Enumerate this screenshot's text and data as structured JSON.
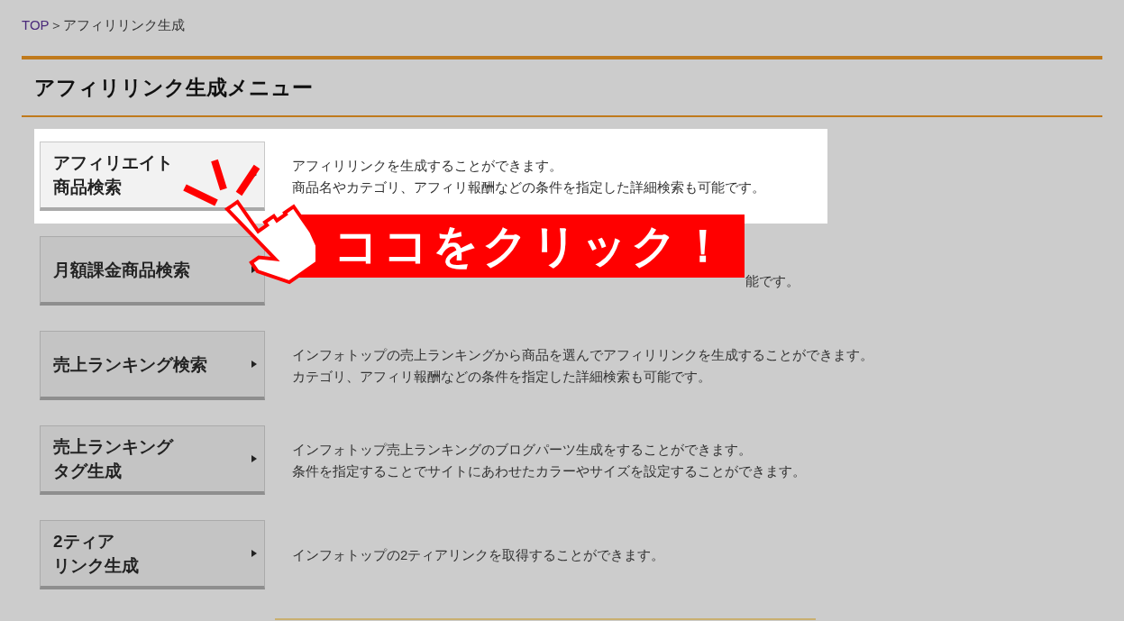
{
  "breadcrumb": {
    "link": "TOP",
    "separator": "＞",
    "current": "アフィリリンク生成"
  },
  "heading": "アフィリリンク生成メニュー",
  "menu": [
    {
      "label": [
        "アフィリエイト",
        "商品検索"
      ],
      "highlighted": true,
      "description": [
        "アフィリリンクを生成することができます。",
        "商品名やカテゴリ、アフィリ報酬などの条件を指定した詳細検索も可能です。"
      ]
    },
    {
      "label": [
        "月額課金商品検索"
      ],
      "highlighted": false,
      "callout": {
        "text": "ココをクリック！"
      },
      "description": [
        "能です。"
      ]
    },
    {
      "label": [
        "売上ランキング検索"
      ],
      "highlighted": false,
      "description": [
        "インフォトップの売上ランキングから商品を選んでアフィリリンクを生成することができます。",
        "カテゴリ、アフィリ報酬などの条件を指定した詳細検索も可能です。"
      ]
    },
    {
      "label": [
        "売上ランキング",
        "タグ生成"
      ],
      "highlighted": false,
      "description": [
        "インフォトップ売上ランキングのブログパーツ生成をすることができます。",
        "条件を指定することでサイトにあわせたカラーやサイズを設定することができます。"
      ]
    },
    {
      "label": [
        "2ティア",
        "リンク生成"
      ],
      "highlighted": false,
      "description": [
        "インフォトップの2ティアリンクを取得することができます。"
      ]
    }
  ]
}
